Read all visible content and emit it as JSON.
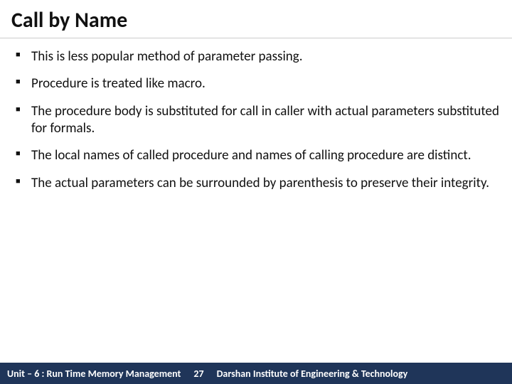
{
  "title": "Call by Name",
  "bullets": [
    "This is less popular method of parameter passing.",
    "Procedure is treated like macro.",
    "The procedure body is substituted for call in caller with actual parameters substituted for formals.",
    "The local names of called procedure and names of calling procedure are distinct.",
    "The actual parameters can be surrounded by parenthesis to preserve their integrity."
  ],
  "footer": {
    "unit": "Unit – 6 : Run Time Memory Management",
    "page": "27",
    "institute": "Darshan Institute of Engineering & Technology"
  }
}
